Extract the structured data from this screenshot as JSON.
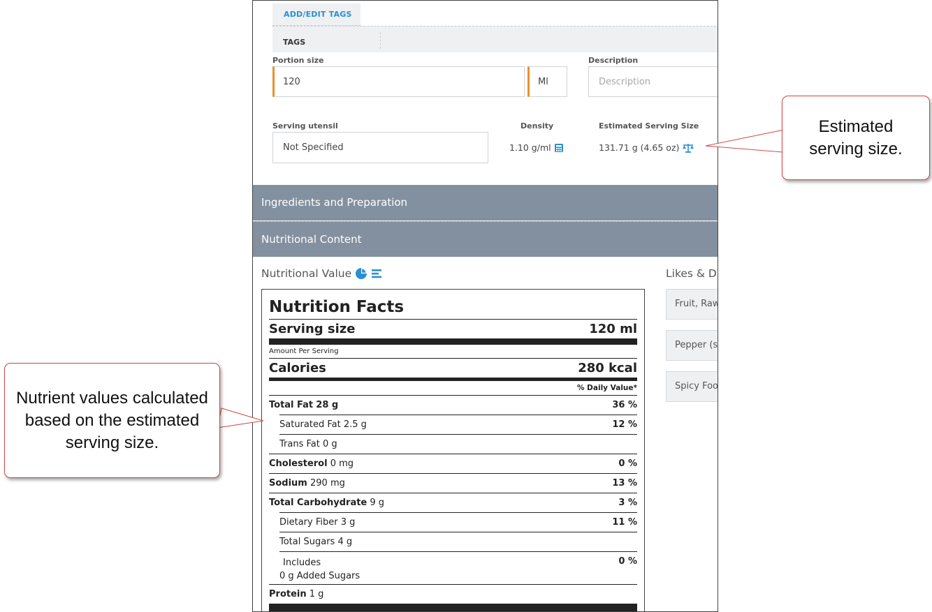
{
  "tabs": {
    "add_edit_tags": "ADD/EDIT TAGS",
    "tags": "TAGS"
  },
  "form": {
    "portion_size": {
      "label": "Portion size",
      "value": "120",
      "unit": "Ml"
    },
    "description": {
      "label": "Description",
      "placeholder": "Description"
    },
    "serving_utensil": {
      "label": "Serving utensil",
      "value": "Not Specified"
    },
    "density": {
      "label": "Density",
      "value": "1.10 g/ml"
    },
    "estimated_serving_size": {
      "label": "Estimated Serving Size",
      "value": "131.71 g (4.65 oz)"
    }
  },
  "sections": {
    "ingredients": "Ingredients and Preparation",
    "nutritional": "Nutritional Content"
  },
  "nutritional_value": {
    "title": "Nutritional Value"
  },
  "likes": {
    "title": "Likes & D",
    "items": [
      "Fruit, Raw",
      "Pepper (s",
      "Spicy Foo"
    ]
  },
  "nutrition_facts": {
    "title": "Nutrition Facts",
    "serving_size_label": "Serving size",
    "serving_size_value": "120 ml",
    "amount_per_serving": "Amount Per Serving",
    "calories_label": "Calories",
    "calories_value": "280 kcal",
    "daily_value_header": "% Daily Value*",
    "rows": [
      {
        "name": "Total Fat",
        "amount": "28 g",
        "dv": "36 %"
      },
      {
        "name": "Saturated Fat",
        "amount": "2.5 g",
        "dv": "12 %"
      },
      {
        "name": "Trans Fat",
        "amount": "0 g",
        "dv": ""
      },
      {
        "name": "Cholesterol",
        "amount": "0 mg",
        "dv": "0 %"
      },
      {
        "name": "Sodium",
        "amount": "290 mg",
        "dv": "13 %"
      },
      {
        "name": "Total Carbohydrate",
        "amount": "9 g",
        "dv": "3 %"
      },
      {
        "name": "Dietary Fiber",
        "amount": "3 g",
        "dv": "11 %"
      },
      {
        "name": "Total Sugars",
        "amount": "4 g",
        "dv": ""
      },
      {
        "name": "Includes",
        "amount": "0 g Added Sugars",
        "dv": "0 %"
      },
      {
        "name": "Protein",
        "amount": "1 g",
        "dv": ""
      }
    ]
  },
  "callouts": {
    "estimated": "Estimated serving size.",
    "nutrient": "Nutrient values calculated based on the estimated serving size."
  },
  "colors": {
    "accent": "#2a8fd0",
    "required": "#e8912d",
    "section_bar": "#8390a0",
    "callout_border": "#d04848"
  }
}
